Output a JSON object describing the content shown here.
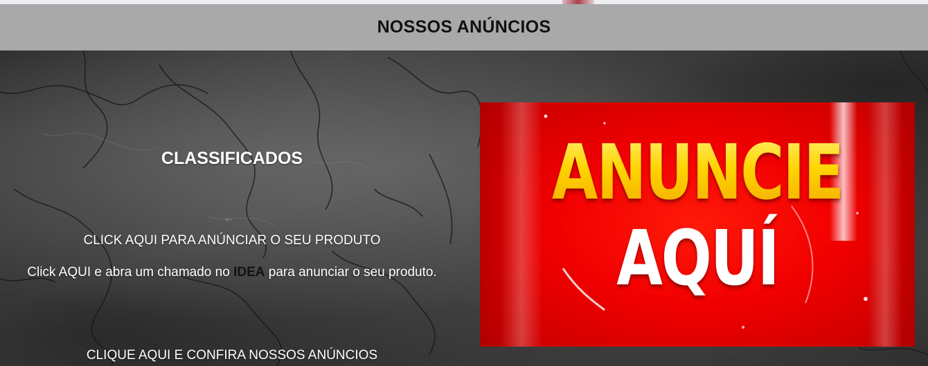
{
  "header": {
    "title": "NOSSOS ANÚNCIOS"
  },
  "classifieds": {
    "title": "CLASSIFICADOS",
    "small_mark": "<--",
    "advertise_link": "CLICK AQUI PARA ANÚNCIAR O SEU PRODUTO",
    "description_before": "Click AQUI e abra um chamado no ",
    "description_brand": "IDEA",
    "description_after": " para anunciar o seu produto.",
    "view_ads_link": "CLIQUE AQUI E CONFIRA NOSSOS ANÚNCIOS"
  },
  "banner": {
    "line1": "ANUNCIE",
    "line2": "AQUÍ"
  },
  "colors": {
    "header_bg": "#a9a9a9",
    "banner_red": "#f20000",
    "banner_yellow": "#ffd400",
    "text_light": "#ffffff",
    "text_dark": "#111111"
  }
}
